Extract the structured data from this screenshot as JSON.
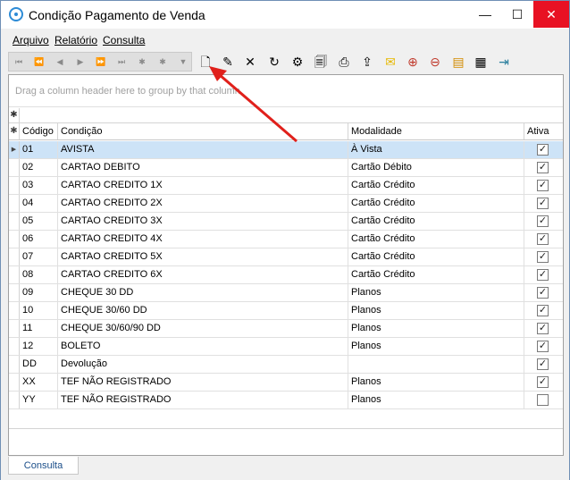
{
  "window": {
    "title": "Condição Pagamento de Venda",
    "controls": {
      "minimize": "—",
      "maximize": "☐",
      "close": "✕"
    }
  },
  "menu": {
    "items": [
      "Arquivo",
      "Relatório",
      "Consulta"
    ]
  },
  "toolbar": {
    "nav_buttons": [
      "⏮",
      "⏪",
      "◀",
      "▶",
      "⏩",
      "⏭",
      "✱",
      "✱",
      "▼"
    ],
    "tools": [
      {
        "icon": "new-document-icon",
        "glyph": "🗋"
      },
      {
        "icon": "edit-document-icon",
        "glyph": "✎"
      },
      {
        "icon": "delete-icon",
        "glyph": "✕"
      },
      {
        "icon": "refresh-icon",
        "glyph": "↻"
      },
      {
        "icon": "properties-icon",
        "glyph": "⚙"
      },
      {
        "icon": "preview-icon",
        "glyph": "🗐"
      },
      {
        "icon": "print-icon",
        "glyph": "⎙"
      },
      {
        "icon": "export-icon",
        "glyph": "⇪"
      },
      {
        "icon": "email-icon",
        "glyph": "✉"
      },
      {
        "icon": "zoom-in-icon",
        "glyph": "⊕"
      },
      {
        "icon": "zoom-out-icon",
        "glyph": "⊖"
      },
      {
        "icon": "columns-icon",
        "glyph": "▤"
      },
      {
        "icon": "layout-icon",
        "glyph": "▦"
      },
      {
        "icon": "exit-icon",
        "glyph": "⇥"
      }
    ],
    "colors": {
      "new-document-icon": "#333333",
      "delete-icon": "#111111",
      "email-icon": "#e6b800",
      "zoom-in-icon": "#c0392b",
      "zoom-out-icon": "#c0392b",
      "columns-icon": "#d28b00",
      "exit-icon": "#2a7f9e"
    }
  },
  "grid": {
    "group_panel_text": "Drag a column header here to group by that column",
    "filter_indicator": "✱",
    "header_indicator": "✱",
    "columns": [
      "Código",
      "Condição",
      "Modalidade",
      "Ativa"
    ],
    "rows": [
      {
        "codigo": "01",
        "condicao": "AVISTA",
        "modalidade": "À Vista",
        "ativa": true,
        "selected": true
      },
      {
        "codigo": "02",
        "condicao": "CARTAO DEBITO",
        "modalidade": "Cartão Débito",
        "ativa": true
      },
      {
        "codigo": "03",
        "condicao": "CARTAO CREDITO 1X",
        "modalidade": "Cartão Crédito",
        "ativa": true
      },
      {
        "codigo": "04",
        "condicao": "CARTAO CREDITO 2X",
        "modalidade": "Cartão Crédito",
        "ativa": true
      },
      {
        "codigo": "05",
        "condicao": "CARTAO CREDITO 3X",
        "modalidade": "Cartão Crédito",
        "ativa": true
      },
      {
        "codigo": "06",
        "condicao": "CARTAO CREDITO 4X",
        "modalidade": "Cartão Crédito",
        "ativa": true
      },
      {
        "codigo": "07",
        "condicao": "CARTAO CREDITO 5X",
        "modalidade": "Cartão Crédito",
        "ativa": true
      },
      {
        "codigo": "08",
        "condicao": "CARTAO CREDITO 6X",
        "modalidade": "Cartão Crédito",
        "ativa": true
      },
      {
        "codigo": "09",
        "condicao": "CHEQUE 30 DD",
        "modalidade": "Planos",
        "ativa": true
      },
      {
        "codigo": "10",
        "condicao": "CHEQUE 30/60 DD",
        "modalidade": "Planos",
        "ativa": true
      },
      {
        "codigo": "11",
        "condicao": "CHEQUE 30/60/90 DD",
        "modalidade": "Planos",
        "ativa": true
      },
      {
        "codigo": "12",
        "condicao": "BOLETO",
        "modalidade": "Planos",
        "ativa": true
      },
      {
        "codigo": "DD",
        "condicao": "Devolução",
        "modalidade": "",
        "ativa": true
      },
      {
        "codigo": "XX",
        "condicao": "TEF NÃO REGISTRADO",
        "modalidade": "Planos",
        "ativa": true
      },
      {
        "codigo": "YY",
        "condicao": "TEF NÃO REGISTRADO",
        "modalidade": "Planos",
        "ativa": false
      }
    ],
    "selected_row_marker": "▶",
    "check_glyph": "✓"
  },
  "tabs": {
    "active": "Consulta"
  },
  "annotation": {
    "arrow_color": "#e0201b"
  }
}
